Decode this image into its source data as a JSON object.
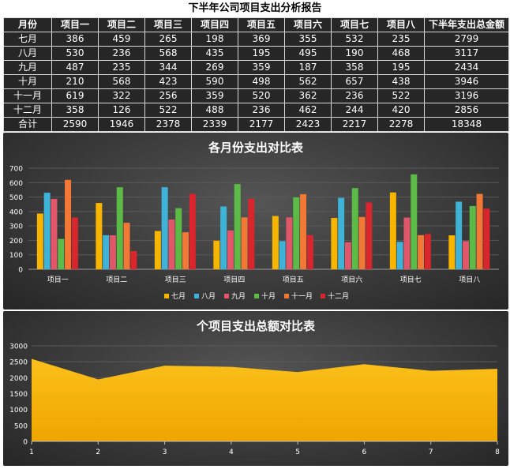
{
  "title": "下半年公司项目支出分析报告",
  "table": {
    "headers": [
      "月份",
      "项目一",
      "项目二",
      "项目三",
      "项目四",
      "项目五",
      "项目六",
      "项目七",
      "项目八",
      "下半年支出总金额"
    ],
    "rows": [
      [
        "七月",
        "386",
        "459",
        "265",
        "198",
        "369",
        "355",
        "532",
        "235",
        "2799"
      ],
      [
        "八月",
        "530",
        "236",
        "568",
        "435",
        "195",
        "495",
        "190",
        "468",
        "3117"
      ],
      [
        "九月",
        "487",
        "235",
        "344",
        "269",
        "359",
        "187",
        "358",
        "195",
        "2434"
      ],
      [
        "十月",
        "210",
        "568",
        "423",
        "590",
        "498",
        "562",
        "657",
        "438",
        "3946"
      ],
      [
        "十一月",
        "619",
        "322",
        "256",
        "359",
        "520",
        "362",
        "236",
        "522",
        "3196"
      ],
      [
        "十二月",
        "358",
        "126",
        "522",
        "488",
        "236",
        "462",
        "244",
        "420",
        "2856"
      ],
      [
        "合计",
        "2590",
        "1946",
        "2378",
        "2339",
        "2177",
        "2423",
        "2217",
        "2278",
        "18348"
      ]
    ]
  },
  "chart_data": [
    {
      "type": "bar",
      "title": "各月份支出对比表",
      "categories": [
        "项目一",
        "项目二",
        "项目三",
        "项目四",
        "项目五",
        "项目六",
        "项目七",
        "项目八"
      ],
      "series": [
        {
          "name": "七月",
          "color": "#f7b500",
          "values": [
            386,
            459,
            265,
            198,
            369,
            355,
            532,
            235
          ]
        },
        {
          "name": "八月",
          "color": "#3fb2d8",
          "values": [
            530,
            236,
            568,
            435,
            195,
            495,
            190,
            468
          ]
        },
        {
          "name": "九月",
          "color": "#e2566a",
          "values": [
            487,
            235,
            344,
            269,
            359,
            187,
            358,
            195
          ]
        },
        {
          "name": "十月",
          "color": "#5cba47",
          "values": [
            210,
            568,
            423,
            590,
            498,
            562,
            657,
            438
          ]
        },
        {
          "name": "十一月",
          "color": "#f27935",
          "values": [
            619,
            322,
            256,
            359,
            520,
            362,
            236,
            522
          ]
        },
        {
          "name": "十二月",
          "color": "#d9262c",
          "values": [
            358,
            126,
            522,
            488,
            236,
            462,
            244,
            420
          ]
        }
      ],
      "ylim": [
        0,
        700
      ],
      "yticks": [
        0,
        100,
        200,
        300,
        400,
        500,
        600,
        700
      ],
      "legend": "bottom",
      "grid": true
    },
    {
      "type": "area",
      "title": "个项目支出总额对比表",
      "x": [
        1,
        2,
        3,
        4,
        5,
        6,
        7,
        8
      ],
      "values": [
        2590,
        1946,
        2378,
        2339,
        2177,
        2423,
        2217,
        2278
      ],
      "color": "#f7b500",
      "ylim": [
        0,
        3000
      ],
      "yticks": [
        0,
        500,
        1000,
        1500,
        2000,
        2500,
        3000
      ],
      "grid": true
    }
  ]
}
